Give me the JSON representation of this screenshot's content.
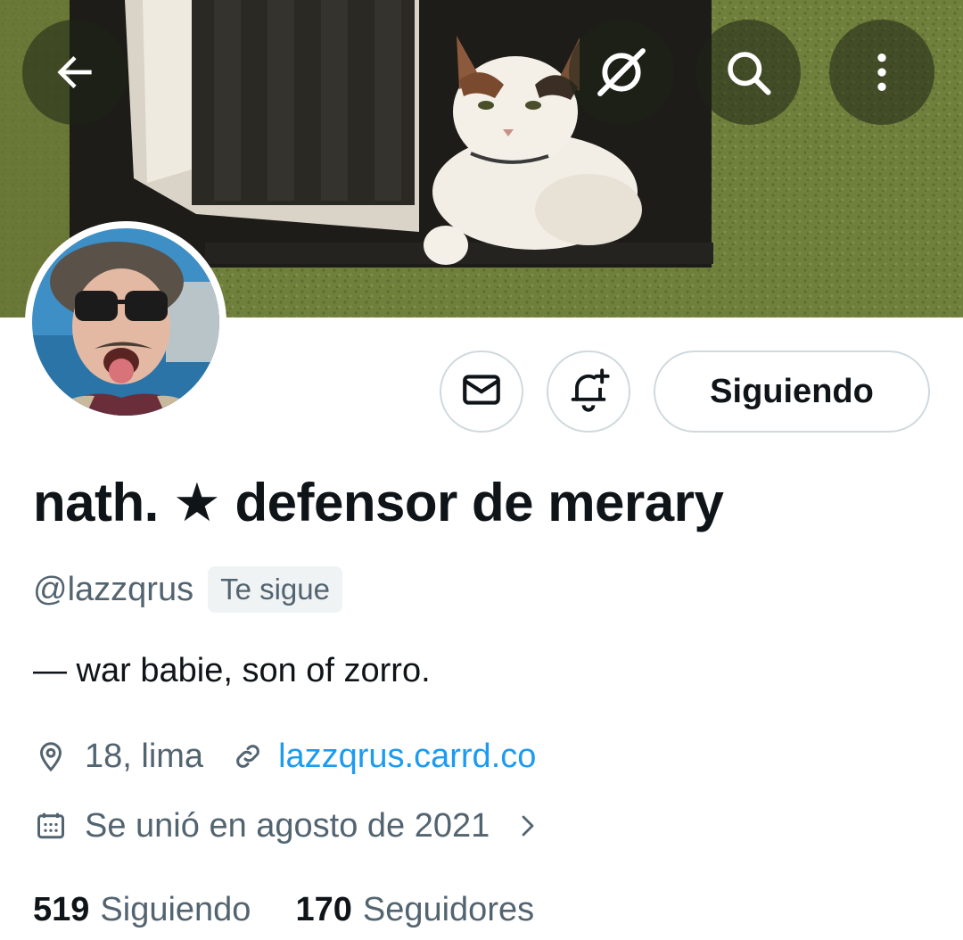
{
  "header": {
    "back_icon": "arrow-left-icon",
    "grok_icon": "grok-icon",
    "search_icon": "search-icon",
    "more_icon": "more-vertical-icon"
  },
  "actions": {
    "message_icon": "envelope-icon",
    "notify_icon": "bell-plus-icon",
    "following_label": "Siguiendo"
  },
  "profile": {
    "display_name": "nath. ★ defensor de merary",
    "handle": "@lazzqrus",
    "follows_you_badge": "Te sigue",
    "bio": "— war babie, son of zorro.",
    "location": "18, lima",
    "website": "lazzqrus.carrd.co",
    "joined": "Se unió en agosto de 2021"
  },
  "stats": {
    "following_count": "519",
    "following_label": "Siguiendo",
    "followers_count": "170",
    "followers_label": "Seguidores"
  },
  "colors": {
    "text_primary": "#0f1419",
    "text_secondary": "#536471",
    "link": "#1d9bf0",
    "border": "#cfd9de",
    "badge_bg": "#eff3f4"
  }
}
